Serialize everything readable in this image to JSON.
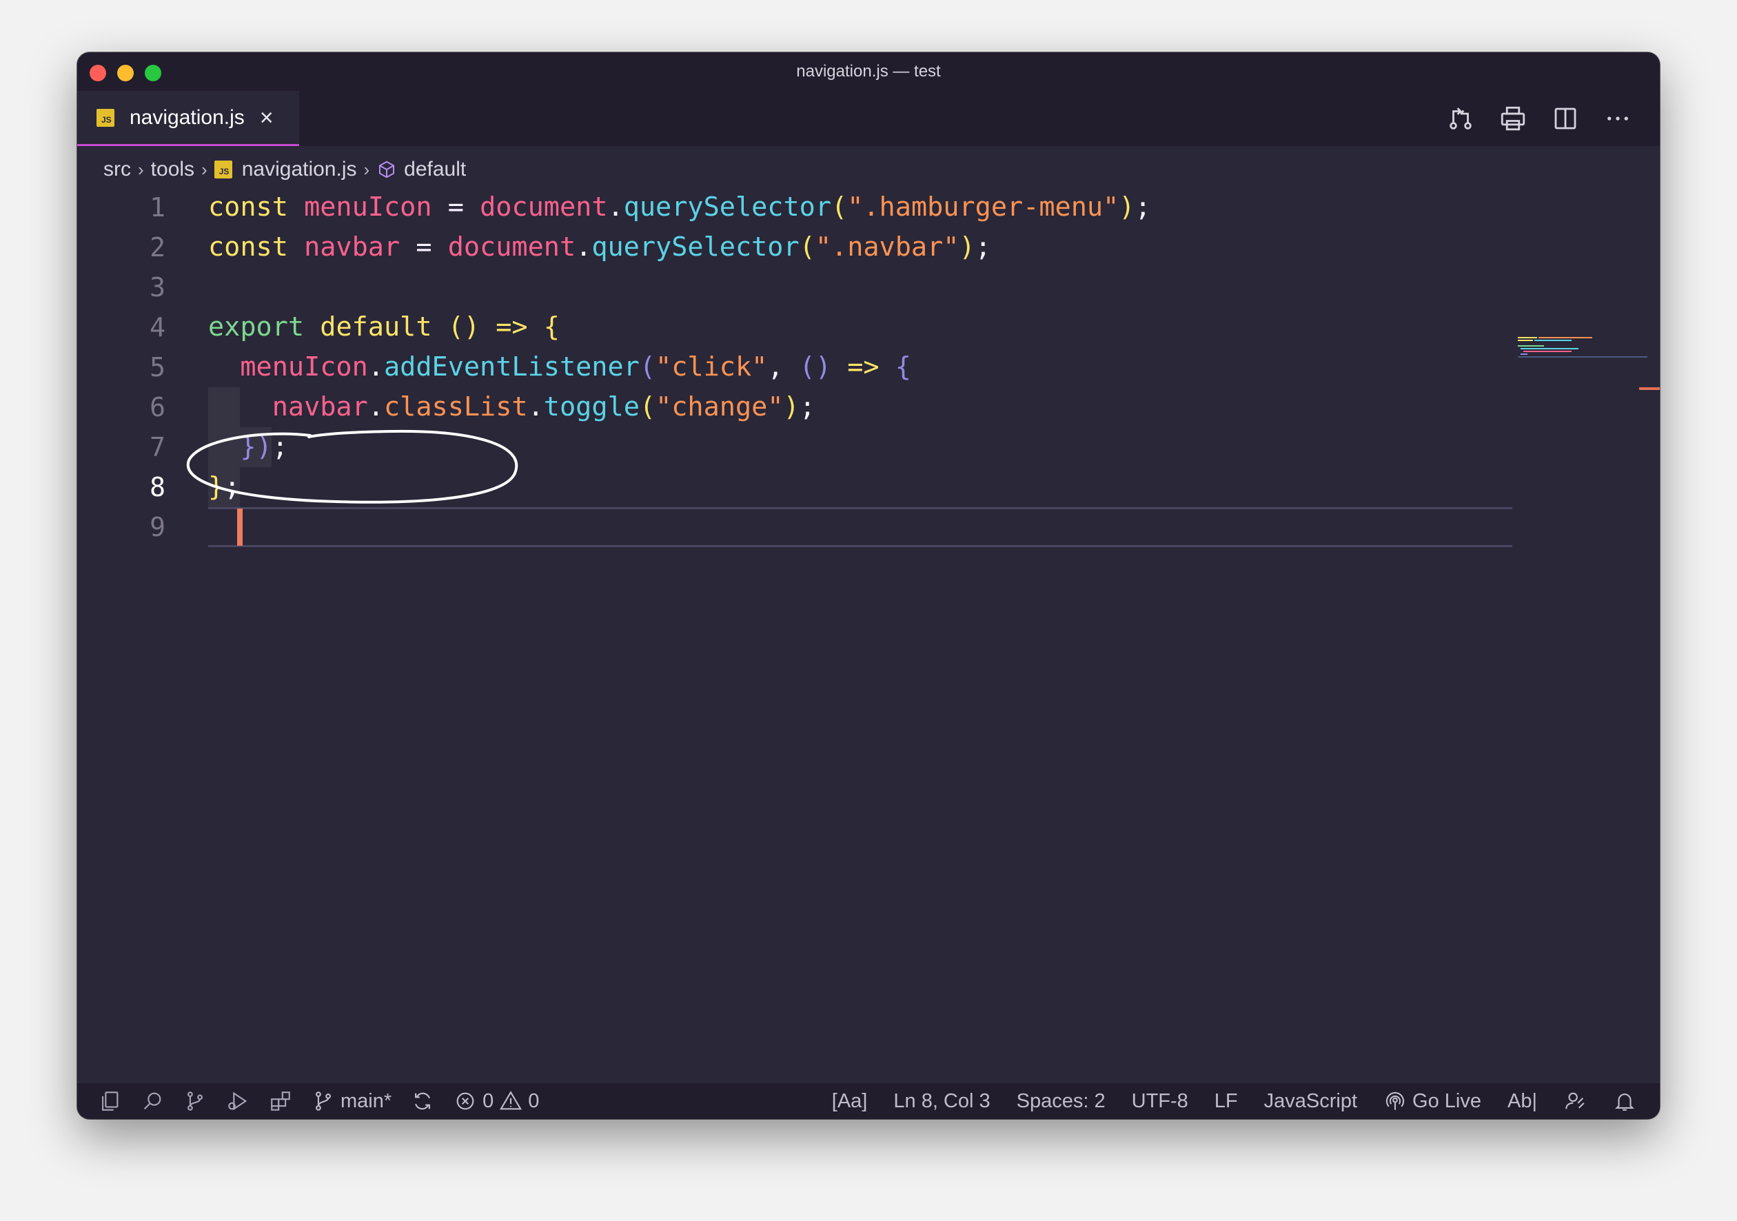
{
  "window": {
    "title": "navigation.js — test"
  },
  "tab": {
    "icon": "js-file-icon",
    "badge": "JS",
    "label": "navigation.js",
    "close_glyph": "×"
  },
  "tab_actions": [
    "compare-changes-icon",
    "print-icon",
    "split-editor-icon",
    "more-actions-icon"
  ],
  "breadcrumb": {
    "items": [
      "src",
      "tools",
      "navigation.js",
      "default"
    ],
    "separator": "›",
    "file_badge": "JS"
  },
  "editor": {
    "active_line": 8,
    "line_numbers": [
      "1",
      "2",
      "3",
      "4",
      "5",
      "6",
      "7",
      "8",
      "9"
    ],
    "lines": [
      [
        [
          "kw",
          "const "
        ],
        [
          "id",
          "menuIcon"
        ],
        [
          "pn",
          " = "
        ],
        [
          "id",
          "document"
        ],
        [
          "pn",
          "."
        ],
        [
          "mt",
          "querySelector"
        ],
        [
          "pr",
          "("
        ],
        [
          "st",
          "\".hamburger-menu\""
        ],
        [
          "pr",
          ")"
        ],
        [
          "pn",
          ";"
        ]
      ],
      [
        [
          "kw",
          "const "
        ],
        [
          "id",
          "navbar"
        ],
        [
          "pn",
          " = "
        ],
        [
          "id",
          "document"
        ],
        [
          "pn",
          "."
        ],
        [
          "mt",
          "querySelector"
        ],
        [
          "pr",
          "("
        ],
        [
          "st",
          "\".navbar\""
        ],
        [
          "pr",
          ")"
        ],
        [
          "pn",
          ";"
        ]
      ],
      [],
      [
        [
          "ex",
          "export "
        ],
        [
          "kw",
          "default "
        ],
        [
          "pr",
          "()"
        ],
        [
          "arrow",
          " => "
        ],
        [
          "pr",
          "{"
        ]
      ],
      [
        [
          "pn",
          "  "
        ],
        [
          "id",
          "menuIcon"
        ],
        [
          "pn",
          "."
        ],
        [
          "mt",
          "addEventListener"
        ],
        [
          "pr2",
          "("
        ],
        [
          "st",
          "\"click\""
        ],
        [
          "pn",
          ", "
        ],
        [
          "pr2",
          "()"
        ],
        [
          "arrow",
          " => "
        ],
        [
          "pr2",
          "{"
        ]
      ],
      [
        [
          "pn",
          "    "
        ],
        [
          "id",
          "navbar"
        ],
        [
          "pn",
          "."
        ],
        [
          "st",
          "classList"
        ],
        [
          "pn",
          "."
        ],
        [
          "mt",
          "toggle"
        ],
        [
          "pr",
          "("
        ],
        [
          "st",
          "\"change\""
        ],
        [
          "pr",
          ")"
        ],
        [
          "pn",
          ";"
        ]
      ],
      [
        [
          "pn",
          "  "
        ],
        [
          "pr2",
          "})"
        ],
        [
          "pn",
          ";"
        ]
      ],
      [
        [
          "pr",
          "}"
        ],
        [
          "pn",
          ";"
        ]
      ],
      []
    ]
  },
  "status_bar": {
    "left_icons": [
      "explorer-icon",
      "search-icon",
      "source-control-icon",
      "run-debug-icon",
      "extensions-icon"
    ],
    "branch": "main*",
    "errors": "0",
    "warnings": "0",
    "right": {
      "case": "[Aa]",
      "position": "Ln 8, Col 3",
      "spaces": "Spaces: 2",
      "encoding": "UTF-8",
      "eol": "LF",
      "language": "JavaScript",
      "go_live": "Go Live",
      "abl": "Ab|"
    }
  },
  "colors": {
    "editor_bg": "#2a2738",
    "chrome_bg": "#211d2d",
    "keyword": "#fce566",
    "identifier": "#fc618d",
    "method": "#5ad4e6",
    "string": "#fd9353",
    "export": "#7bd88f",
    "cursor": "#ed7d5e"
  }
}
